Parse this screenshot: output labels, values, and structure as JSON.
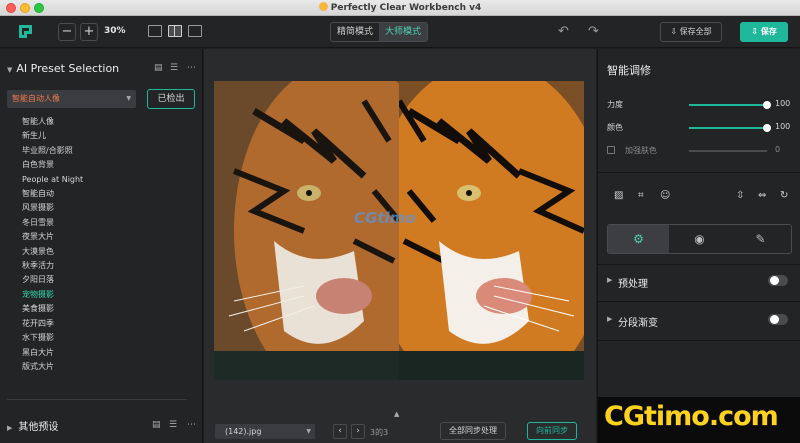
{
  "window": {
    "title": "Perfectly Clear Workbench v4"
  },
  "toolbar": {
    "zoom_out": "−",
    "zoom_in": "+",
    "zoom_value": "30%",
    "modes": [
      {
        "label": "精简模式",
        "active": false
      },
      {
        "label": "大师模式",
        "active": true
      }
    ],
    "save_all": "保存全部",
    "save": "保存"
  },
  "left": {
    "section_title": "AI Preset Selection",
    "selected_preset": "智能自动人像",
    "detected_button": "已检出",
    "presets": [
      "智能人像",
      "新生儿",
      "毕业照/合影照",
      "白色背景",
      "People at Night",
      "智能自动",
      "风景摄影",
      "冬日雪景",
      "夜景大片",
      "大漠景色",
      "秋季活力",
      "夕阳日落",
      "宠物摄影",
      "美食摄影",
      "花开四季",
      "水下摄影",
      "黑白大片",
      "版式大片"
    ],
    "active_preset": "宠物摄影",
    "other_title": "其他预设"
  },
  "canvas": {
    "watermark": "CGtimo",
    "file_name": "(142).jpg",
    "page_counter": "3的3",
    "sync_all": "全部同步处理",
    "sync_forward": "向前同步"
  },
  "right": {
    "title": "智能调修",
    "sliders": [
      {
        "label": "力度",
        "value": "100",
        "fraction": 1.0
      },
      {
        "label": "颜色",
        "value": "100",
        "fraction": 1.0
      },
      {
        "label": "加强肤色",
        "value": "0",
        "fraction": 0.0
      }
    ],
    "sections": [
      {
        "label": "预处理",
        "enabled": false
      },
      {
        "label": "分段渐变",
        "enabled": false
      }
    ]
  },
  "site_watermark": "CGtimo.com",
  "colors": {
    "accent": "#1fb89a",
    "preset_orange": "#f07a4f",
    "watermark_yellow": "#ffd21f"
  }
}
